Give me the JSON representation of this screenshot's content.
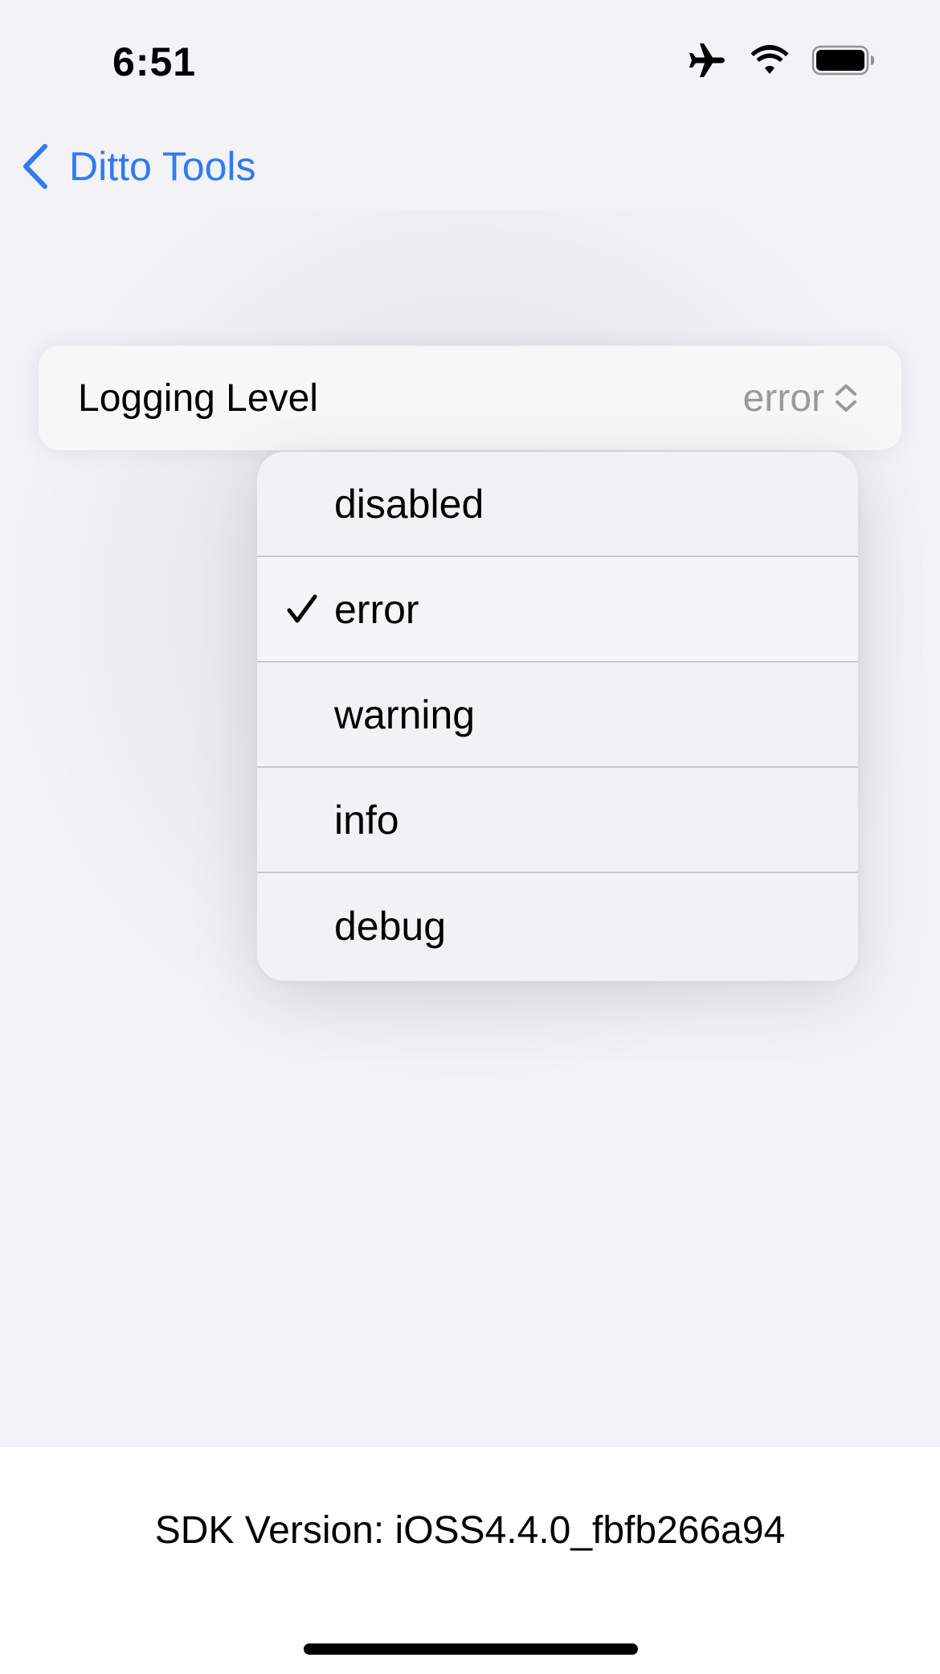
{
  "status_bar": {
    "time": "6:51",
    "icons": [
      "airplane-icon",
      "wifi-icon",
      "battery-icon"
    ]
  },
  "nav": {
    "back_label": "Ditto Tools"
  },
  "settings": {
    "logging_label": "Logging Level",
    "logging_value": "error"
  },
  "menu": {
    "options": [
      {
        "label": "disabled",
        "selected": false
      },
      {
        "label": "error",
        "selected": true
      },
      {
        "label": "warning",
        "selected": false
      },
      {
        "label": "info",
        "selected": false
      },
      {
        "label": "debug",
        "selected": false
      }
    ]
  },
  "footer": {
    "sdk_version": "SDK Version: iOSS4.4.0_fbfb266a94"
  },
  "colors": {
    "accent": "#2f7bf0",
    "background": "#f2f2f7",
    "secondary_text": "#9a9a9e"
  }
}
